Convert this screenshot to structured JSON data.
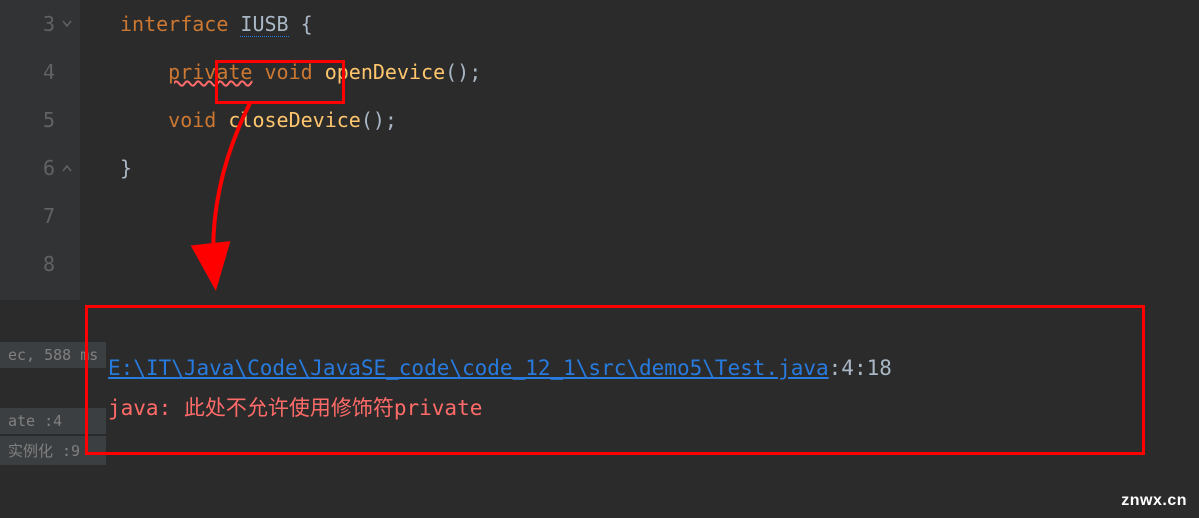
{
  "editor": {
    "lines": {
      "3": "3",
      "4": "4",
      "5": "5",
      "6": "6",
      "7": "7",
      "8": "8"
    },
    "code": {
      "line3_kw": "interface ",
      "line3_type": "IUSB",
      "line3_brace": " {",
      "line4_indent": "    ",
      "line4_private": "private",
      "line4_void": " void ",
      "line4_method": "openDevice",
      "line4_paren": "();",
      "line5_indent": "    ",
      "line5_void": "void ",
      "line5_method": "closeDevice",
      "line5_paren": "();",
      "line6_brace": "}"
    }
  },
  "sidebar": {
    "timing": "ec, 588 ms",
    "ate_label": "ate ",
    "ate_value": ":4",
    "inst_label": "实例化 ",
    "inst_value": ":9"
  },
  "console": {
    "file_path": "E:\\IT\\Java\\Code\\JavaSE_code\\code_12_1\\src\\demo5\\Test.java",
    "line_col": ":4:18",
    "error_prefix": "java: ",
    "error_msg": "此处不允许使用修饰符private"
  },
  "watermark": "znwx.cn"
}
